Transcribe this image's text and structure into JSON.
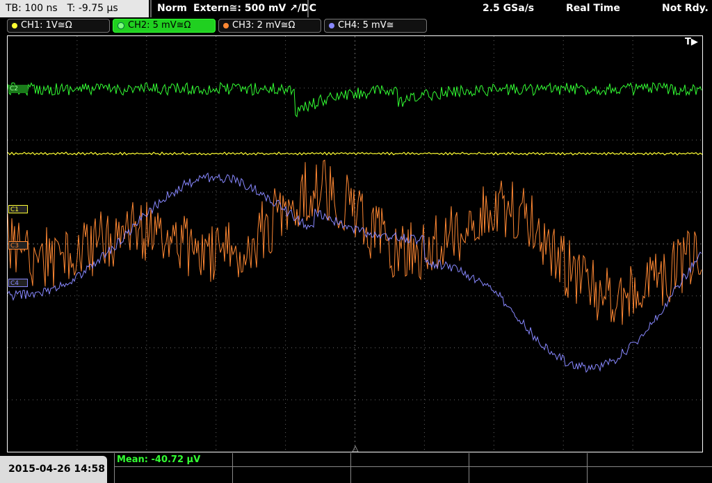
{
  "header": {
    "timebase": "TB: 100 ns",
    "trigger_time": "T: -9.75 µs",
    "mode": "Norm",
    "trigger_source": "Extern≅: 500 mV ↗/DC",
    "sample_rate": "2.5 GSa/s",
    "acq_mode": "Real Time",
    "status": "Not Rdy."
  },
  "channels": [
    {
      "label": "CH1: 1V≅Ω",
      "color": "#ffff33",
      "active": false
    },
    {
      "label": "CH2: 5 mV≅Ω",
      "color": "#33ff33",
      "active": true
    },
    {
      "label": "CH3: 2 mV≅Ω",
      "color": "#ff8833",
      "active": false
    },
    {
      "label": "CH4: 5 mV≅",
      "color": "#8888ff",
      "active": false
    }
  ],
  "markers": {
    "c1": "C1",
    "c2": "C2",
    "c3": "C3",
    "c4": "C4",
    "trigger_arrow": "T▶"
  },
  "footer": {
    "datetime": "2015-04-26 14:58",
    "mean": "Mean: -40.72 µV"
  },
  "colors": {
    "ch1": "#ffff33",
    "ch2": "#33ff33",
    "ch3": "#ff8833",
    "ch4": "#8888ff",
    "grid": "#666666"
  }
}
